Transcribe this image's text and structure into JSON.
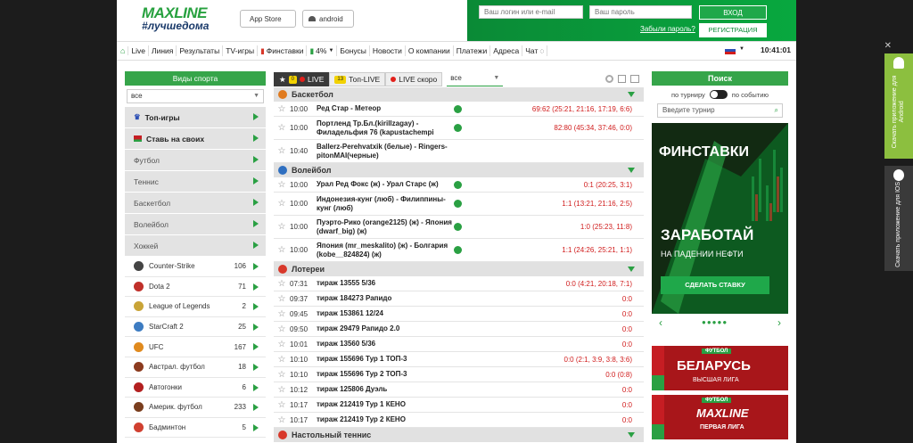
{
  "brand": {
    "logo": "MAXLINE",
    "tagline": "#лучшедома"
  },
  "header": {
    "appstore": "App Store",
    "android": "android",
    "login_placeholder": "Ваш логин или e-mail",
    "password_placeholder": "Ваш пароль",
    "login_button": "ВХОД",
    "forgot": "Забыли пароль?",
    "register": "РЕГИСТРАЦИЯ"
  },
  "nav": {
    "items": [
      "Live",
      "Линия",
      "Результаты",
      "TV-игры",
      "Финставки",
      "4%",
      "Бонусы",
      "Новости",
      "О компании",
      "Платежи",
      "Адреса",
      "Чат"
    ],
    "time": "10:41:01"
  },
  "left": {
    "title": "Виды спорта",
    "select": "все",
    "items": [
      {
        "label": "Топ-игры",
        "bold": true
      },
      {
        "label": "Ставь на своих",
        "bold": true
      },
      {
        "label": "Футбол"
      },
      {
        "label": "Теннис"
      },
      {
        "label": "Баскетбол"
      },
      {
        "label": "Волейбол"
      },
      {
        "label": "Хоккей"
      }
    ],
    "games": [
      {
        "label": "Counter-Strike",
        "count": "106",
        "color": "#444"
      },
      {
        "label": "Dota 2",
        "count": "71",
        "color": "#c0302a"
      },
      {
        "label": "League of Legends",
        "count": "2",
        "color": "#c9a437"
      },
      {
        "label": "StarCraft 2",
        "count": "25",
        "color": "#3d7cc2"
      },
      {
        "label": "UFC",
        "count": "167",
        "color": "#e08a1e"
      },
      {
        "label": "Австрал. футбол",
        "count": "18",
        "color": "#8c3b1f"
      },
      {
        "label": "Автогонки",
        "count": "6",
        "color": "#b32020"
      },
      {
        "label": "Америк. футбол",
        "count": "233",
        "color": "#7a3e1e"
      },
      {
        "label": "Бадминтон",
        "count": "5",
        "color": "#d04030"
      }
    ]
  },
  "center": {
    "tabs": {
      "live_count": "0",
      "live": "LIVE",
      "top_count": "13",
      "top": "Топ-LIVE",
      "soon": "LIVE скоро",
      "filter": "все"
    },
    "sections": [
      {
        "title": "Баскетбол",
        "icon": "#e07a1e",
        "rows": [
          {
            "time": "10:00",
            "name": "Ред Стар - Метеор",
            "live": true,
            "score": "69:62 (25:21, 21:16, 17:19, 6:6)"
          },
          {
            "time": "10:00",
            "name": "Портленд Тр.Бл.(kirillzagay) - Филадельфия 76 (kapustachempi",
            "live": true,
            "score": "82:80 (45:34, 37:46, 0:0)"
          },
          {
            "time": "10:40",
            "name": "Ballerz-Perehvatxik (белые) - Ringers-pitonMAI(черные)",
            "live": false,
            "score": ""
          }
        ]
      },
      {
        "title": "Волейбол",
        "icon": "#2f6fc0",
        "rows": [
          {
            "time": "10:00",
            "name": "Урал Ред Фокс (ж) - Урал Старс (ж)",
            "live": true,
            "score": "0:1 (20:25, 3:1)"
          },
          {
            "time": "10:00",
            "name": "Индонезия-кунг (люб) - Филиппины-кунг (люб)",
            "live": true,
            "score": "1:1 (13:21, 21:16, 2:5)"
          },
          {
            "time": "10:00",
            "name": "Пуэрто-Рико (orange2125) (ж) - Япония (dwarf_big) (ж)",
            "live": true,
            "score": "1:0 (25:23, 11:8)"
          },
          {
            "time": "10:00",
            "name": "Япония (mr_meskalito) (ж) - Болгария (kobe__824824) (ж)",
            "live": true,
            "score": "1:1 (24:26, 25:21, 1:1)"
          }
        ]
      },
      {
        "title": "Лотереи",
        "icon": "#d8382a",
        "rows": [
          {
            "time": "07:31",
            "name": "тираж 13555 5/36",
            "live": false,
            "score": "0:0 (4:21, 20:18, 7:1)"
          },
          {
            "time": "09:37",
            "name": "тираж 184273 Рапидо",
            "live": false,
            "score": "0:0"
          },
          {
            "time": "09:45",
            "name": "тираж 153861 12/24",
            "live": false,
            "score": "0:0"
          },
          {
            "time": "09:50",
            "name": "тираж 29479 Рапидо 2.0",
            "live": false,
            "score": "0:0"
          },
          {
            "time": "10:01",
            "name": "тираж 13560 5/36",
            "live": false,
            "score": "0:0"
          },
          {
            "time": "10:10",
            "name": "тираж 155696 Тур 1 ТОП-3",
            "live": false,
            "score": "0:0 (2:1, 3:9, 3:8, 3:6)"
          },
          {
            "time": "10:10",
            "name": "тираж 155696 Тур 2 ТОП-3",
            "live": false,
            "score": "0:0 (0:8)"
          },
          {
            "time": "10:12",
            "name": "тираж 125806 Дуэль",
            "live": false,
            "score": "0:0"
          },
          {
            "time": "10:17",
            "name": "тираж 212419 Тур 1 КЕНО",
            "live": false,
            "score": "0:0"
          },
          {
            "time": "10:17",
            "name": "тираж 212419 Тур 2 КЕНО",
            "live": false,
            "score": "0:0"
          }
        ]
      },
      {
        "title": "Настольный теннис",
        "icon": "#d8382a",
        "rows": []
      }
    ]
  },
  "right": {
    "title": "Поиск",
    "by_tour": "по турниру",
    "by_event": "по событию",
    "placeholder": "Введите турнир",
    "banner": {
      "title": "ФИНСТАВКИ",
      "line1": "ЗАРАБОТАЙ",
      "line2": "НА ПАДЕНИИ НЕФТИ",
      "button": "СДЕЛАТЬ СТАВКУ"
    },
    "promo1": {
      "tag": "ФУТБОЛ",
      "title": "БЕЛАРУСЬ",
      "sub": "ВЫСШАЯ ЛИГА"
    },
    "promo2": {
      "tag": "ФУТБОЛ",
      "title": "MAXLINE",
      "sub": "ПЕРВАЯ ЛИГА"
    }
  },
  "side": {
    "android": "Скачать приложение для Android",
    "ios": "Скачать приложение для IOS"
  }
}
